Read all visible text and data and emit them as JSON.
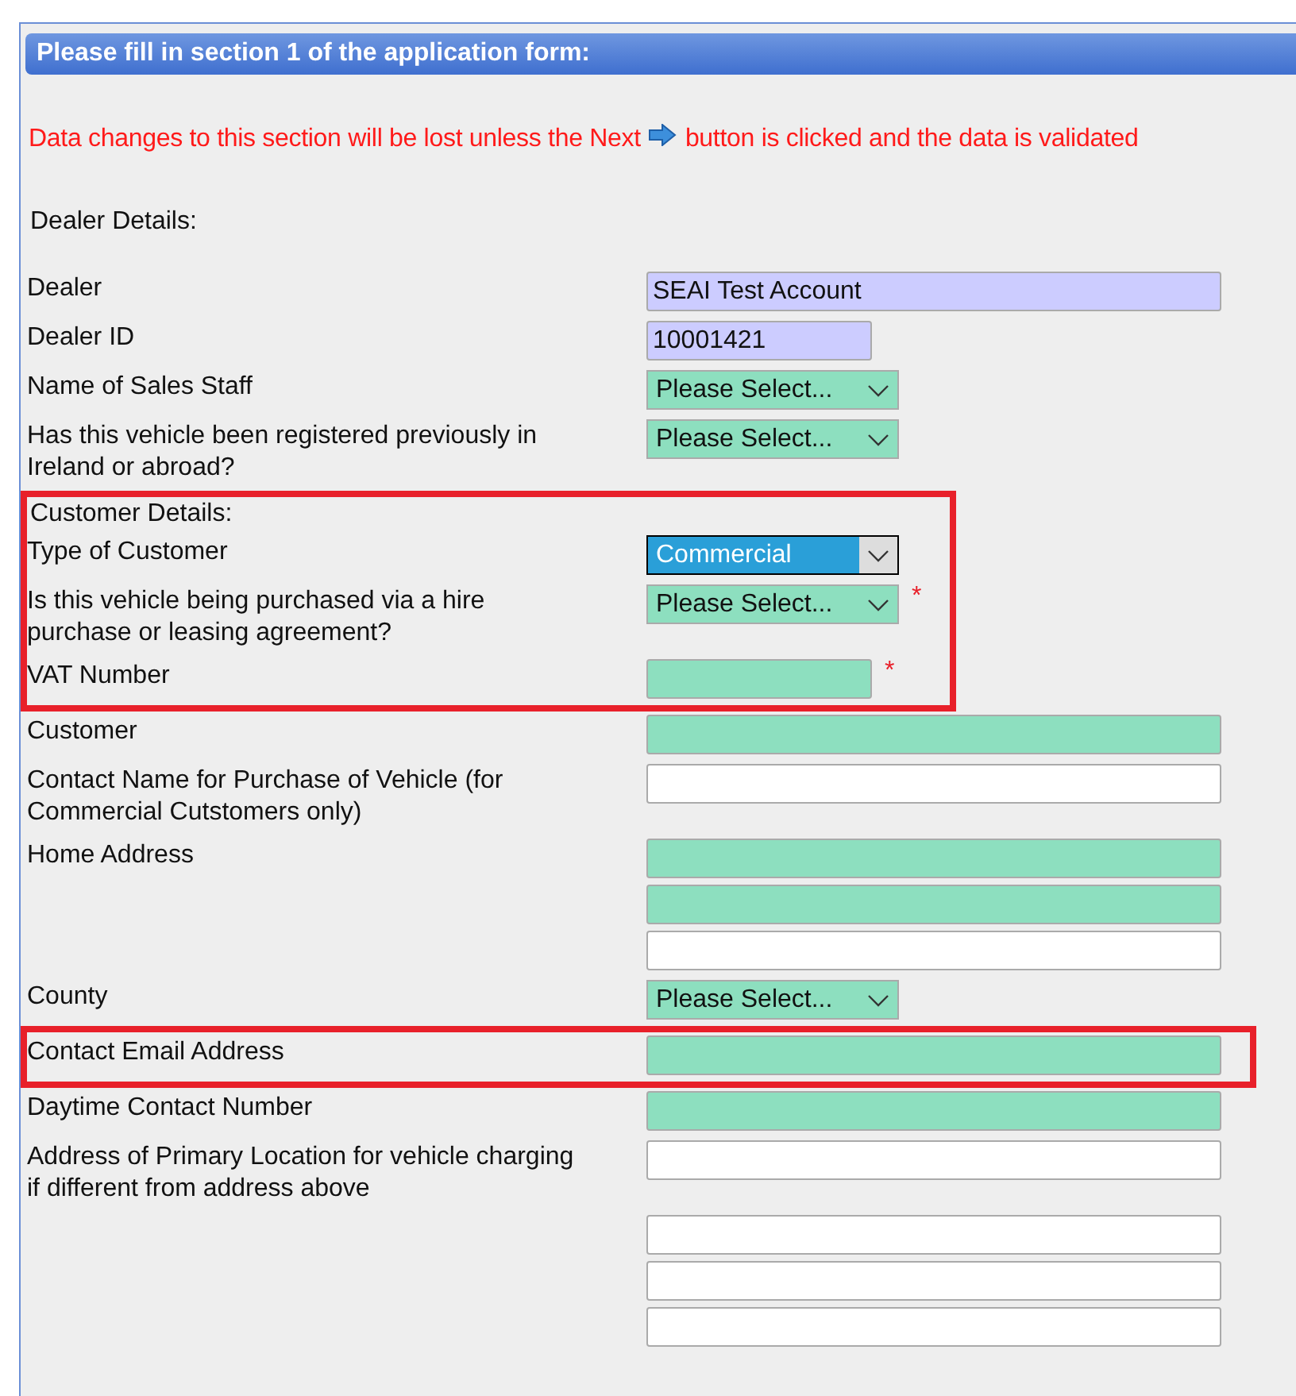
{
  "panel": {
    "title": "Please fill in section 1 of the application form:"
  },
  "notice": {
    "before": "Data changes to this section will be lost unless the Next",
    "after": "button is clicked and the data is validated"
  },
  "rows": [
    {
      "kind": "heading",
      "label": "Dealer Details:",
      "highlighted": false
    },
    {
      "kind": "field",
      "label": "Dealer",
      "highlighted": false,
      "fields": [
        {
          "kind": "input",
          "readonly": true,
          "value": "SEAI Test Account"
        }
      ]
    },
    {
      "kind": "field",
      "label": "Dealer ID",
      "highlighted": false,
      "fields": [
        {
          "kind": "short-input",
          "readonly": true,
          "value": "10001421"
        }
      ]
    },
    {
      "kind": "field",
      "label": "Name of Sales Staff",
      "highlighted": false,
      "fields": [
        {
          "kind": "select",
          "readonly": false,
          "mandatory": true,
          "value": "Please Select..."
        }
      ]
    },
    {
      "kind": "field",
      "label": "Has this vehicle been registered previously in Ireland or abroad?",
      "highlighted": false,
      "fields": [
        {
          "kind": "select",
          "readonly": false,
          "mandatory": true,
          "value": "Please Select..."
        }
      ]
    },
    {
      "kind": "heading",
      "label": "Customer Details:",
      "highlighted": true
    },
    {
      "kind": "field",
      "label": "Type of Customer",
      "highlighted": true,
      "fields": [
        {
          "kind": "select",
          "value": "Commercial",
          "focused": true
        }
      ]
    },
    {
      "kind": "field",
      "label": "Is this vehicle being purchased via a hire purchase or leasing agreement?",
      "highlighted": true,
      "fields": [
        {
          "kind": "select",
          "readonly": false,
          "mandatory": true,
          "value": "Please Select...",
          "marker": "*"
        }
      ]
    },
    {
      "kind": "field",
      "label": "VAT Number",
      "highlighted": true,
      "fields": [
        {
          "kind": "short-input",
          "readonly": false,
          "mandatory": true,
          "marker": "*"
        }
      ]
    },
    {
      "kind": "field",
      "label": "Customer",
      "highlighted": false,
      "fields": [
        {
          "kind": "input",
          "readonly": false,
          "mandatory": true
        }
      ]
    },
    {
      "kind": "field",
      "label": "Contact Name for Purchase of Vehicle (for Commercial Cutstomers only)",
      "highlighted": false,
      "fields": [
        {
          "kind": "input",
          "readonly": false,
          "mandatory": false
        }
      ]
    },
    {
      "kind": "field",
      "label": "Home Address",
      "highlighted": false,
      "fields": [
        {
          "kind": "input",
          "readonly": false,
          "mandatory": true
        },
        {
          "kind": "input",
          "readonly": false,
          "mandatory": true
        },
        {
          "kind": "input",
          "readonly": false,
          "mandatory": false
        }
      ]
    },
    {
      "kind": "field",
      "label": "County",
      "highlighted": false,
      "fields": [
        {
          "kind": "select",
          "readonly": false,
          "mandatory": true,
          "value": "Please Select..."
        }
      ]
    },
    {
      "kind": "field",
      "label": "Contact Email Address",
      "highlighted": true,
      "fields": [
        {
          "kind": "input",
          "readonly": false,
          "mandatory": true
        }
      ]
    },
    {
      "kind": "field",
      "label": "Daytime Contact Number",
      "highlighted": false,
      "fields": [
        {
          "kind": "input",
          "readonly": false,
          "mandatory": true
        }
      ]
    },
    {
      "kind": "field",
      "label": "Address of Primary Location for vehicle charging if different from address above",
      "highlighted": false,
      "fields": [
        {
          "kind": "input",
          "readonly": false,
          "mandatory": false
        }
      ]
    },
    {
      "kind": "field",
      "highlighted": false,
      "fields": [
        {
          "kind": "input",
          "readonly": false,
          "mandatory": false
        },
        {
          "kind": "input",
          "readonly": false,
          "mandatory": false
        },
        {
          "kind": "input",
          "readonly": false,
          "mandatory": false
        }
      ]
    }
  ]
}
